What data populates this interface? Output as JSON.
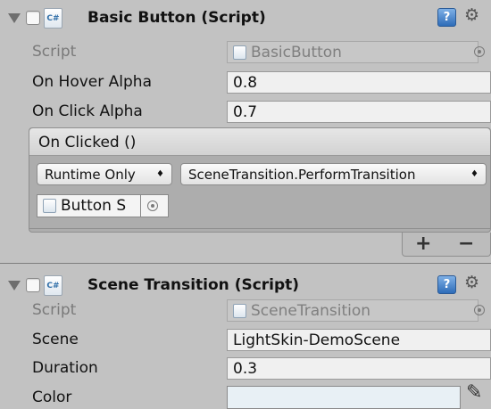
{
  "basic_button": {
    "title": "Basic Button (Script)",
    "icon_text": "C#",
    "help_glyph": "?",
    "gear_glyph": "⚙",
    "script_label": "Script",
    "script_value": "BasicButton",
    "on_hover_alpha_label": "On Hover Alpha",
    "on_hover_alpha_value": "0.8",
    "on_click_alpha_label": "On Click Alpha",
    "on_click_alpha_value": "0.7",
    "event_title": "On Clicked ()",
    "runtime_option": "Runtime Only",
    "function_option": "SceneTransition.PerformTransition",
    "target_object": "Button S",
    "add_glyph": "+",
    "remove_glyph": "−",
    "popup_arrows": "♦"
  },
  "scene_transition": {
    "title": "Scene Transition (Script)",
    "icon_text": "C#",
    "help_glyph": "?",
    "gear_glyph": "⚙",
    "script_label": "Script",
    "script_value": "SceneTransition",
    "scene_label": "Scene",
    "scene_value": "LightSkin-DemoScene",
    "duration_label": "Duration",
    "duration_value": "0.3",
    "color_label": "Color",
    "color_value": "#e8f0f5",
    "eyedropper_glyph": "✎"
  },
  "colors": {
    "inspector_bg": "#c2c2c2",
    "field_bg": "#f0f0f0",
    "event_bg": "#adadad"
  }
}
